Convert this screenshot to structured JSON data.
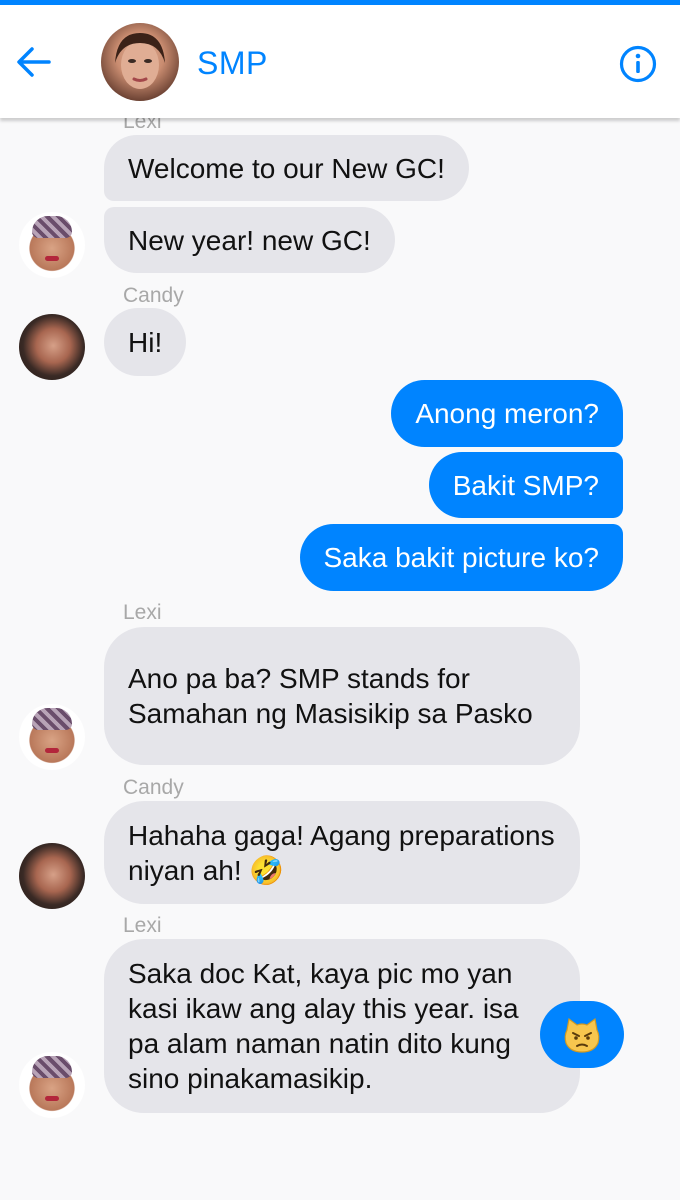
{
  "app": {
    "accent_color": "#0084ff",
    "header": {
      "title": "SMP",
      "back_icon": "arrow-left-icon",
      "info_icon": "info-circle-icon"
    }
  },
  "messages": {
    "top_sender_cut": "Lexi",
    "m1": "Welcome to our New GC!",
    "m2": "New year! new GC!",
    "s2": "Candy",
    "m3": "Hi!",
    "m4": "Anong meron?",
    "m5": "Bakit SMP?",
    "m6": "Saka bakit picture ko?",
    "s3": "Lexi",
    "m7": "Ano pa ba? SMP stands for Samahan ng Masisikip sa Pasko",
    "s4": "Candy",
    "m8": "Hahaha gaga! Agang preparations niyan ah! 🤣",
    "s5": "Lexi",
    "m9": "Saka doc Kat, kaya pic mo yan kasi ikaw ang alay this year. isa pa alam naman natin dito kung sino pinakamasikip.",
    "m10_emoji": "angry-cat-emoji"
  }
}
